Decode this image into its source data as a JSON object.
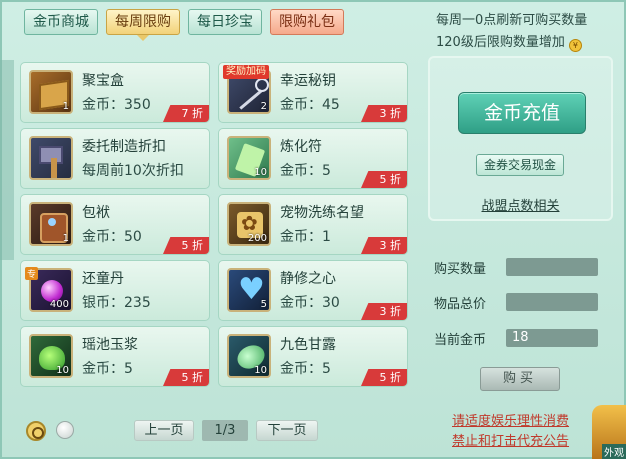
{
  "tabs": [
    {
      "label": "金币商城",
      "state": "normal"
    },
    {
      "label": "每周限购",
      "state": "active"
    },
    {
      "label": "每日珍宝",
      "state": "normal"
    },
    {
      "label": "限购礼包",
      "state": "special"
    }
  ],
  "info": {
    "line1": "每周一0点刷新可购买数量",
    "line2": "120级后限购数量增加",
    "coin_icon_char": "¥"
  },
  "items": [
    {
      "name": "聚宝盒",
      "price": "金币：350",
      "qty": "1",
      "discount": "7 折",
      "icon": "treasure-box-icon",
      "badge": ""
    },
    {
      "name": "幸运秘钥",
      "price": "金币：45",
      "qty": "2",
      "discount": "3 折",
      "icon": "key-icon",
      "badge": "奖励加码"
    },
    {
      "name": "委托制造折扣",
      "price": "每周前10次折扣",
      "qty": "",
      "discount": "",
      "icon": "hammer-icon",
      "badge": ""
    },
    {
      "name": "炼化符",
      "price": "金币：5",
      "qty": "10",
      "discount": "5 折",
      "icon": "talisman-icon",
      "badge": ""
    },
    {
      "name": "包袱",
      "price": "金币：50",
      "qty": "1",
      "discount": "5 折",
      "icon": "bag-icon",
      "badge": ""
    },
    {
      "name": "宠物洗练名望",
      "price": "金币：1",
      "qty": "200",
      "discount": "3 折",
      "icon": "pet-emblem-icon",
      "badge": ""
    },
    {
      "name": "还童丹",
      "price": "银币：235",
      "qty": "400",
      "discount": "",
      "icon": "pill-icon",
      "badge": "",
      "corner": "专"
    },
    {
      "name": "静修之心",
      "price": "金币：30",
      "qty": "5",
      "discount": "3 折",
      "icon": "heart-crystal-icon",
      "badge": ""
    },
    {
      "name": "瑶池玉浆",
      "price": "金币：5",
      "qty": "10",
      "discount": "5 折",
      "icon": "jade-jar-icon",
      "badge": ""
    },
    {
      "name": "九色甘露",
      "price": "金币：5",
      "qty": "10",
      "discount": "5 折",
      "icon": "gourd-icon",
      "badge": ""
    }
  ],
  "panel": {
    "recharge": "金币充值",
    "voucher": "金券交易现金",
    "alliance": "战盟点数相关"
  },
  "form": {
    "buy_qty_label": "购买数量",
    "buy_qty_value": "",
    "total_label": "物品总价",
    "total_value": "",
    "current_label": "当前金币",
    "current_value": "18",
    "buy_button": "购买"
  },
  "pager": {
    "prev": "上一页",
    "page": "1/3",
    "next": "下一页"
  },
  "notice": {
    "line1": "请适度娱乐理性消费",
    "line2": "禁止和打击代充公告"
  },
  "corner_label": "外观"
}
